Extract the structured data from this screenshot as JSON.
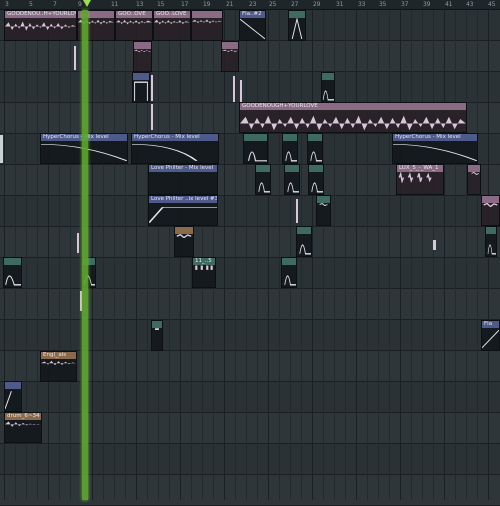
{
  "ruler": {
    "bars": [
      "3",
      "5",
      "7",
      "9",
      "11",
      "13",
      "15",
      "17",
      "19",
      "21",
      "23",
      "25",
      "27",
      "29",
      "31",
      "33",
      "35",
      "37",
      "39",
      "41",
      "43",
      "45"
    ]
  },
  "clips": {
    "goodenough_a": "GOODENOU..H+YOURLOVE",
    "goodenough_b": "GOO..OVE",
    "goodenough_c": "GOO..LOVE",
    "fla": "Fla..#2",
    "goodenough_long": "GOODENOUGH+YOURLOVE",
    "hyperchorus_a": "HyperChorus - Mix level",
    "hyperchorus_b": "HyperChorus - Mix level",
    "hyperchorus_c": "HyperChorus - Mix level",
    "lovephilter_a": "Love Philter - Mix level",
    "lovephilter_b": "Love Philter ..ix level #3",
    "lux": "LUX_5_-_WA_1",
    "hitclip": "11_..5",
    "eng": "Eng(_ais",
    "drum": "drum_6~34",
    "fla_right": "Fla"
  },
  "colors": {
    "audio": "#8a6a84",
    "automation": "#4e5a8a",
    "playhead": "#5fa82c",
    "wave": "#d9c6d8"
  }
}
